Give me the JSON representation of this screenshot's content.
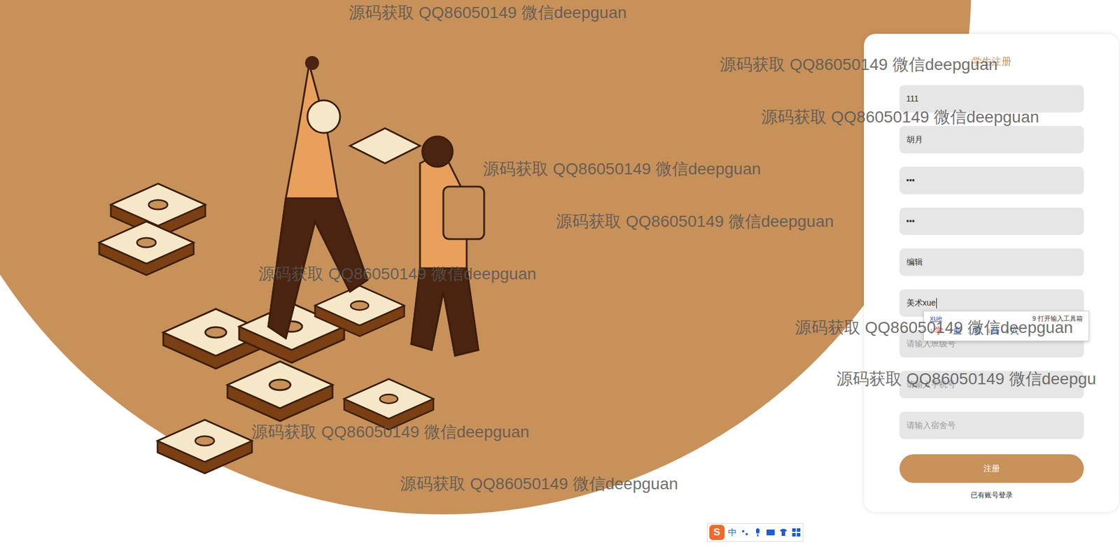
{
  "form": {
    "title": "学生注册",
    "fields": [
      {
        "value": "111",
        "placeholder": "",
        "focused": false
      },
      {
        "value": "胡月",
        "placeholder": "",
        "focused": false
      },
      {
        "value": "•••",
        "placeholder": "",
        "focused": false
      },
      {
        "value": "•••",
        "placeholder": "",
        "focused": false
      },
      {
        "value": "编辑",
        "placeholder": "",
        "focused": false
      },
      {
        "value": "美术xue",
        "placeholder": "",
        "focused": true
      },
      {
        "value": "",
        "placeholder": "请输入班级号",
        "focused": false
      },
      {
        "value": "",
        "placeholder": "请输入手机号",
        "focused": false
      },
      {
        "value": "",
        "placeholder": "请输入宿舍号",
        "focused": false
      }
    ],
    "submit": "注册",
    "login_link": "已有账号登录"
  },
  "ime": {
    "composition": "xue",
    "toolbox": "9 打开输入工具箱",
    "candidates": [
      {
        "index": "1",
        "text": "学",
        "selected": true
      },
      {
        "index": "2",
        "text": "血",
        "selected": false
      },
      {
        "index": "3",
        "text": "雪",
        "selected": false
      },
      {
        "index": "4",
        "text": "薛",
        "selected": false
      },
      {
        "index": "5",
        "text": "穴",
        "selected": false
      }
    ]
  },
  "ime_toolbar": {
    "logo": "S",
    "mode": "中"
  },
  "watermarks": [
    "源码获取 QQ86050149 微信deepguan",
    "源码获取 QQ86050149 微信deepguan",
    "源码获取 QQ86050149 微信deepguan",
    "源码获取 QQ86050149 微信deepguan",
    "源码获取 QQ86050149 微信deepguan",
    "源码获取 QQ86050149 微信deepguan",
    "源码获取 QQ86050149 微信deepguan",
    "源码获取 QQ86050149 微信deepgu",
    "源码获取 QQ86050149 微信deepguan",
    "源码获取 QQ86050149 微信deepguan"
  ]
}
